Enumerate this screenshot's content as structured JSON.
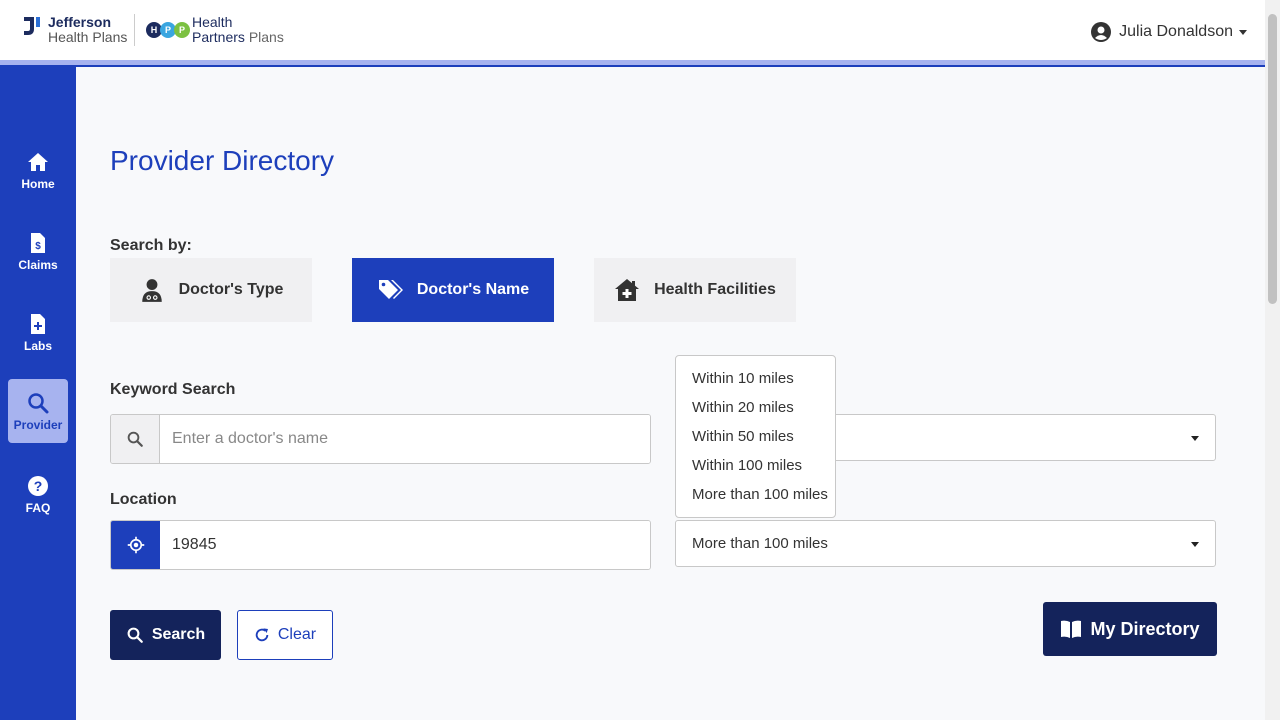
{
  "header": {
    "logo_jefferson_line1": "Jefferson",
    "logo_jefferson_line2": "Health Plans",
    "logo_hpp_letters": [
      "H",
      "P",
      "P"
    ],
    "logo_hpp_line1": "Health",
    "logo_hpp_line2_bold": "Partners",
    "logo_hpp_line2_light": "Plans",
    "user_name": "Julia Donaldson"
  },
  "sidebar": {
    "items": [
      {
        "label": "Home",
        "icon": "home-icon"
      },
      {
        "label": "Claims",
        "icon": "claims-document-icon"
      },
      {
        "label": "Labs",
        "icon": "labs-document-plus-icon"
      },
      {
        "label": "Provider",
        "icon": "search-icon",
        "active": true
      },
      {
        "label": "FAQ",
        "icon": "question-circle-icon"
      }
    ]
  },
  "page": {
    "title": "Provider Directory",
    "search_by_label": "Search by:"
  },
  "tabs": [
    {
      "label": "Doctor's Type",
      "icon": "doctor-icon"
    },
    {
      "label": "Doctor's Name",
      "icon": "tags-icon",
      "active": true
    },
    {
      "label": "Health Facilities",
      "icon": "house-medical-icon"
    }
  ],
  "keyword": {
    "label": "Keyword Search",
    "placeholder": "Enter a doctor's name",
    "value": ""
  },
  "location": {
    "label": "Location",
    "value": "19845"
  },
  "distance": {
    "selected": "More than 100 miles",
    "options": [
      "Within 10 miles",
      "Within 20 miles",
      "Within 50 miles",
      "Within 100 miles",
      "More than 100 miles"
    ]
  },
  "buttons": {
    "search": "Search",
    "clear": "Clear",
    "my_directory": "My Directory"
  },
  "colors": {
    "brand_blue": "#1d3fbb",
    "navy": "#14235b",
    "light_blue": "#a7b3ef"
  }
}
